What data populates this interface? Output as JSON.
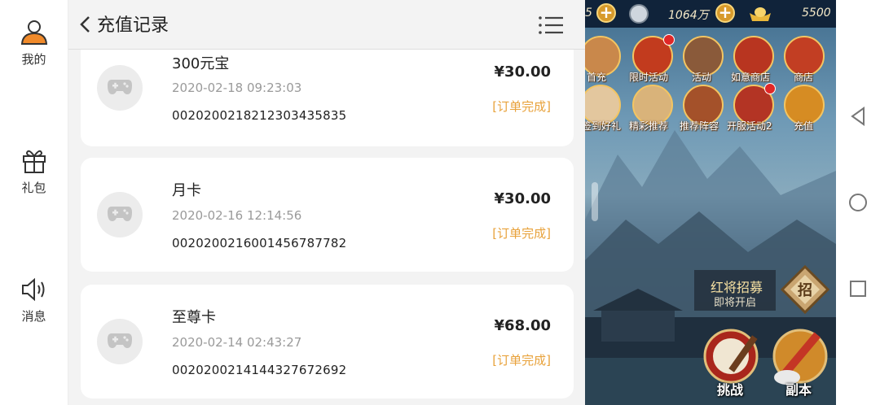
{
  "sidebar": {
    "items": [
      {
        "label": "我的",
        "icon": "user-icon"
      },
      {
        "label": "礼包",
        "icon": "gift-icon"
      },
      {
        "label": "消息",
        "icon": "speaker-icon"
      }
    ]
  },
  "header": {
    "title": "充值记录",
    "back_icon": "chevron-left-icon",
    "menu_icon": "menu-list-icon"
  },
  "records": [
    {
      "name": "300元宝",
      "date": "2020-02-18 09:23:03",
      "order": "002020021821230343583​5",
      "price": "¥30.00",
      "status": "[订单完成]"
    },
    {
      "name": "月卡",
      "date": "2020-02-16 12:14:56",
      "order": "0020200216001456787782",
      "price": "¥30.00",
      "status": "[订单完成]"
    },
    {
      "name": "至尊卡",
      "date": "2020-02-14 02:43:27",
      "order": "0020200214144327672692",
      "price": "¥68.00",
      "status": "[订单完成]"
    }
  ],
  "game": {
    "topbar": {
      "left_partial": "5",
      "silver": "1064万",
      "gold": "5500"
    },
    "row1": [
      {
        "label": "首充",
        "badge": false
      },
      {
        "label": "限时活动",
        "badge": true
      },
      {
        "label": "活动",
        "badge": false
      },
      {
        "label": "如意商店",
        "badge": false
      },
      {
        "label": "商店",
        "badge": false
      }
    ],
    "row2": [
      {
        "label": "签到好礼",
        "badge": false
      },
      {
        "label": "精彩推荐",
        "badge": false
      },
      {
        "label": "推荐阵容",
        "badge": false
      },
      {
        "label": "开服活动2",
        "badge": true
      },
      {
        "label": "充值",
        "badge": false
      }
    ],
    "recruit": {
      "title": "红将招募",
      "subtitle": "即将开启",
      "badge_char": "招"
    },
    "battle_label": "挑战",
    "dungeon_label": "副本"
  },
  "navbar": {
    "back": "back-triangle-icon",
    "home": "home-circle-icon",
    "recent": "recent-square-icon"
  },
  "colors": {
    "status_orange": "#e8a23b",
    "panel_bg": "#f3f3f3",
    "card_bg": "#ffffff"
  }
}
